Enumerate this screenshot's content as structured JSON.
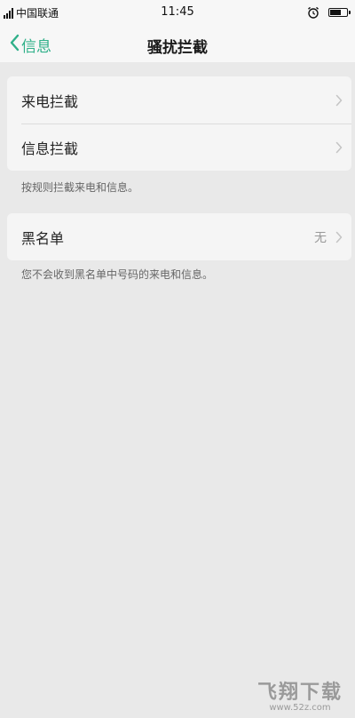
{
  "status_bar": {
    "carrier": "中国联通",
    "time": "11:45",
    "battery_level": 0.7
  },
  "nav": {
    "back_label": "信息",
    "title": "骚扰拦截"
  },
  "groups": [
    {
      "items": [
        {
          "label": "来电拦截",
          "value": ""
        },
        {
          "label": "信息拦截",
          "value": ""
        }
      ],
      "caption": "按规则拦截来电和信息。"
    },
    {
      "items": [
        {
          "label": "黑名单",
          "value": "无"
        }
      ],
      "caption": "您不会收到黑名单中号码的来电和信息。"
    }
  ],
  "watermark": {
    "logo": "飞翔下载",
    "url": "www.52z.com"
  },
  "colors": {
    "accent": "#2fb089",
    "background": "#e9e9e9",
    "card": "#f5f5f5"
  }
}
